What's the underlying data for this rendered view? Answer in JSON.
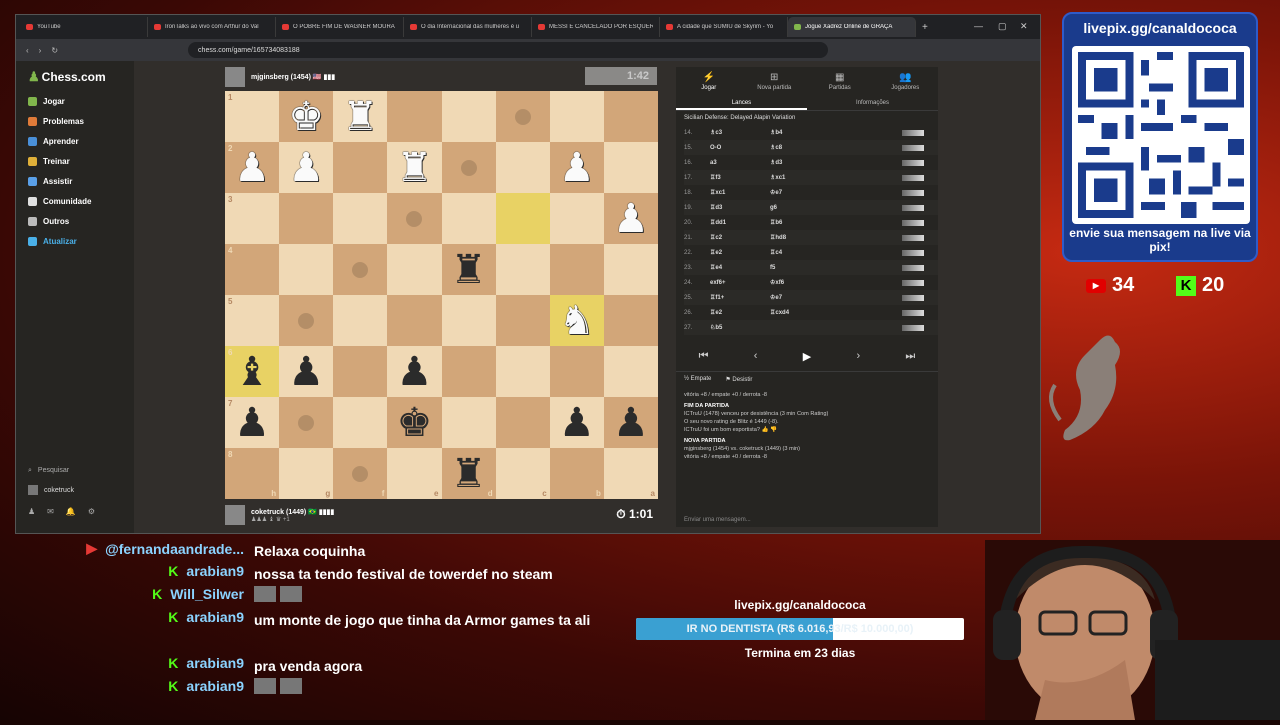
{
  "tabs": [
    {
      "title": "YouTube",
      "active": false
    },
    {
      "title": "IronTalks ao vivo com Arthur do Val",
      "active": false
    },
    {
      "title": "O POBRE FIM DE WAGNER MOURA",
      "active": false
    },
    {
      "title": "O dia Internacional das mulheres é u",
      "active": false
    },
    {
      "title": "MESSI É CANCELADO POR ESQUER",
      "active": false
    },
    {
      "title": "A cidade que SUMIU de Skyrim - Yo",
      "active": false
    },
    {
      "title": "Jogue Xadrez Online de GRAÇA",
      "active": true
    }
  ],
  "url": "chess.com/game/165734083188",
  "sidebar": {
    "logo": "Chess.com",
    "items": [
      {
        "label": "Jogar",
        "color": "#81b64c"
      },
      {
        "label": "Problemas",
        "color": "#e07b39"
      },
      {
        "label": "Aprender",
        "color": "#4a90d9"
      },
      {
        "label": "Treinar",
        "color": "#e0b039"
      },
      {
        "label": "Assistir",
        "color": "#5aa0e8"
      },
      {
        "label": "Comunidade",
        "color": "#e0e0e0"
      },
      {
        "label": "Outros",
        "color": "#bbbbbb"
      },
      {
        "label": "Atualizar",
        "color": "#4ab0e8"
      }
    ],
    "search": "Pesquisar",
    "user": "coketruck"
  },
  "top_player": {
    "name": "mjginsberg (1454) 🇺🇸 ▮▮▮",
    "clock": "1:42"
  },
  "bottom_player": {
    "name": "coketruck (1449) 🇧🇷 ▮▮▮▮",
    "captured": "♟♟♟ ♝ ♛ +1",
    "clock": "1:01"
  },
  "board": {
    "ranks": [
      "1",
      "2",
      "3",
      "4",
      "5",
      "6",
      "7",
      "8"
    ],
    "files": [
      "h",
      "g",
      "f",
      "e",
      "d",
      "c",
      "b",
      "a"
    ],
    "rows": [
      [
        "",
        "wK",
        "wR",
        "",
        "",
        ".",
        "",
        ""
      ],
      [
        "wP",
        "wP",
        "",
        "wR",
        ".",
        "",
        "wP",
        ""
      ],
      [
        "",
        "",
        "",
        ".",
        "",
        "HL",
        "",
        "wP"
      ],
      [
        "",
        "",
        ".",
        "",
        "bR",
        "",
        "",
        ""
      ],
      [
        "",
        ".",
        "",
        "",
        "",
        "",
        "wN*",
        ""
      ],
      [
        "bB*",
        "bP",
        "",
        "bP",
        "",
        "",
        "",
        ""
      ],
      [
        "bP",
        ".",
        "",
        "bK",
        "",
        "",
        "bP",
        "bP"
      ],
      [
        "",
        "",
        ".",
        "",
        "bR",
        "",
        "",
        ""
      ]
    ]
  },
  "panel": {
    "tabs": [
      {
        "label": "Jogar",
        "glyph": "⚡"
      },
      {
        "label": "Nova partida",
        "glyph": "⊞"
      },
      {
        "label": "Partidas",
        "glyph": "▦"
      },
      {
        "label": "Jogadores",
        "glyph": "👥"
      }
    ],
    "subtabs": [
      "Lances",
      "Informações"
    ],
    "opening": "Sicilian Defense: Delayed Alapin Variation",
    "moves": [
      {
        "n": "14.",
        "w": "♗c3",
        "b": "♗b4"
      },
      {
        "n": "15.",
        "w": "O-O",
        "b": "♗c8"
      },
      {
        "n": "16.",
        "w": "a3",
        "b": "♗d3"
      },
      {
        "n": "17.",
        "w": "♖f3",
        "b": "♗xc1"
      },
      {
        "n": "18.",
        "w": "♖xc1",
        "b": "♔e7"
      },
      {
        "n": "19.",
        "w": "♖d3",
        "b": "g6"
      },
      {
        "n": "20.",
        "w": "♖dd1",
        "b": "♖b6"
      },
      {
        "n": "21.",
        "w": "♖c2",
        "b": "♖hd8"
      },
      {
        "n": "22.",
        "w": "♖e2",
        "b": "♖c4"
      },
      {
        "n": "23.",
        "w": "♖e4",
        "b": "f5"
      },
      {
        "n": "24.",
        "w": "exf6+",
        "b": "♔xf6"
      },
      {
        "n": "25.",
        "w": "♖f1+",
        "b": "♔e7"
      },
      {
        "n": "26.",
        "w": "♖e2",
        "b": "♖cxd4"
      },
      {
        "n": "27.",
        "w": "♘b5",
        "b": ""
      }
    ],
    "nav": [
      "⏮",
      "‹",
      "▶",
      "›",
      "⏭"
    ],
    "actions": [
      "½ Empate",
      "⚑ Desistir"
    ],
    "log": [
      {
        "t": "vitória +8 / empate +0 / derrota -8",
        "h": false
      },
      {
        "t": "FIM DA PARTIDA",
        "h": true
      },
      {
        "t": "ICTruU (1478) venceu por desistência (3 min Com Rating)",
        "h": false
      },
      {
        "t": "O seu novo rating de Blitz é 1449 (-8).",
        "h": false
      },
      {
        "t": "ICTruU foi um bom esportista?  👍 👎",
        "h": false
      },
      {
        "t": "NOVA PARTIDA",
        "h": true
      },
      {
        "t": "mjginsberg (1454) vs. coketruck (1449) (3 min)",
        "h": false
      },
      {
        "t": "vitória +8 / empate +0 / derrota -8",
        "h": false
      }
    ],
    "chat_placeholder": "Enviar uma mensagem..."
  },
  "overlay": {
    "qr_url": "livepix.gg/canaldococa",
    "qr_cta": "envie sua mensagem na live via pix!",
    "youtube_count": "34",
    "kick_count": "20"
  },
  "chat": [
    {
      "user": "@fernandaandrade...",
      "text": "Relaxa coquinha",
      "kick": false
    },
    {
      "user": "arabian9",
      "text": "nossa ta tendo festival de towerdef no steam",
      "kick": true
    },
    {
      "user": "Will_Silwer",
      "text": "",
      "kick": true
    },
    {
      "user": "arabian9",
      "text": "um monte de jogo que tinha da Armor games ta ali",
      "kick": true
    },
    {
      "user": "arabian9",
      "text": "pra venda agora",
      "kick": true
    },
    {
      "user": "arabian9",
      "text": "",
      "kick": true
    }
  ],
  "goal": {
    "url": "livepix.gg/canaldococa",
    "label": "IR NO DENTISTA (R$ 6.016,93/R$ 10.000,00)",
    "progress": 0.6017,
    "ends": "Termina em 23 dias"
  }
}
